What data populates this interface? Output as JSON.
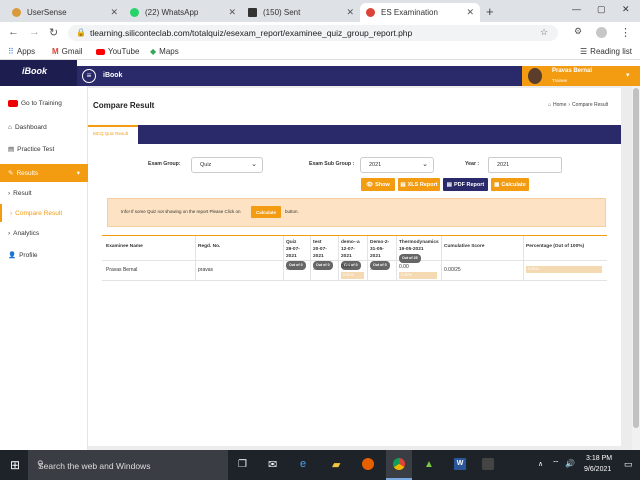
{
  "browser": {
    "tabs": [
      {
        "title": "UserSense",
        "color": "#d89a3a"
      },
      {
        "title": "(22) WhatsApp",
        "color": "#25d366"
      },
      {
        "title": "(150) Sent",
        "color": "#333"
      },
      {
        "title": "ES Examination",
        "color": "#db4437"
      }
    ],
    "new_tab": "+",
    "url": "tlearning.siliconteclab.com/totalquiz/esexam_report/examinee_quiz_group_report.php",
    "bookmarks": [
      "Apps",
      "Gmail",
      "YouTube",
      "Maps"
    ],
    "reading_list": "Reading list"
  },
  "app": {
    "logo": "iBook",
    "header_title": "iBook",
    "user": {
      "name": "Pravas Bernal",
      "role": "Trainee"
    }
  },
  "sidebar": {
    "items": [
      {
        "label": "Go to Training"
      },
      {
        "label": "Dashboard"
      },
      {
        "label": "Practice Test"
      },
      {
        "label": "Results"
      },
      {
        "label": "Result"
      },
      {
        "label": "Compare Result"
      },
      {
        "label": "Analytics"
      },
      {
        "label": "Profile"
      }
    ]
  },
  "page": {
    "title": "Compare Result",
    "breadcrumb_home": "Home",
    "breadcrumb_current": "Compare Result",
    "tab": "MCQ Quiz Result"
  },
  "filters": {
    "exam_group_label": "Exam Group:",
    "exam_group_value": "Quiz",
    "exam_sub_group_label": "Exam Sub Group :",
    "exam_sub_group_value": "2021",
    "year_label": "Year :",
    "year_value": "2021"
  },
  "actions": {
    "show": "Show",
    "xls": "XLS Report",
    "pdf": "PDF Report",
    "calculate": "Calculate"
  },
  "info": {
    "prefix": "Info! If some Quiz not showing on the report Please Click on",
    "button": "Calculate",
    "suffix": "button."
  },
  "table": {
    "headers": {
      "examinee": "Examinee Name",
      "regd": "Regd. No.",
      "quiz": "Quiz\n29-07-\n2021",
      "test": "test\n20-07-\n2021",
      "demo_a": "demo--a\n12-07-\n2021",
      "demo_2": "Demo-2-\n31-05-\n2021",
      "thermo": "Thermodynamics\n19-05-2021",
      "cumulative": "Cumulative Score",
      "percentage": "Percentage (Out of 100%)"
    },
    "pill_quiz": "Out of 0",
    "pill_test": "Out of 0",
    "pill_demo_a": "Out of 0",
    "pill_demo_2": "Out of 0",
    "pill_thermo": "Out of 25",
    "rows": [
      {
        "name": "Pravas Bernal",
        "regd": "pravas",
        "quiz": "-",
        "test": "-",
        "demo_a": "0.00",
        "demo_a_pct": "0.00%",
        "demo_2": "-",
        "thermo": "0.00",
        "thermo_pct": "0.00%",
        "cumulative": "0.00/25",
        "percentage": "0.00%"
      }
    ]
  },
  "taskbar": {
    "search": "Search the web and Windows",
    "time": "3:18 PM",
    "date": "9/6/2021"
  }
}
